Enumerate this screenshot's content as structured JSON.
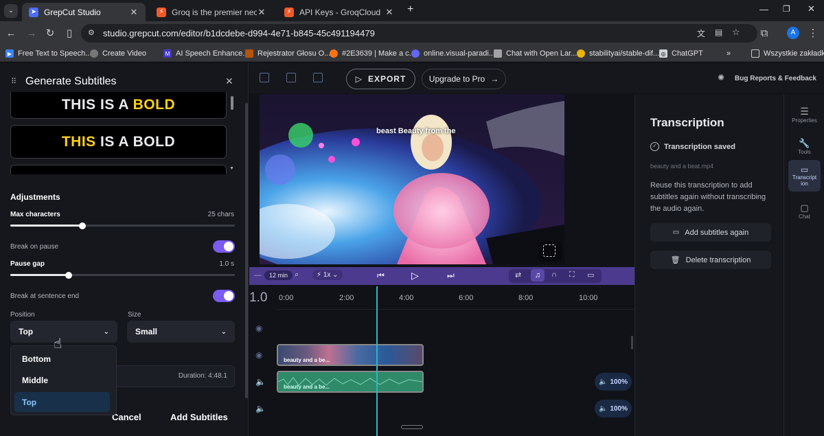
{
  "browser": {
    "tabs": [
      {
        "label": "GrepCut Studio",
        "icon": "grepcut-favicon",
        "color": "#4a6cf7",
        "active": true
      },
      {
        "label": "Groq is the premier neocloud fo",
        "icon": "groq-favicon",
        "color": "#f05a28",
        "active": false
      },
      {
        "label": "API Keys - GroqCloud",
        "icon": "groq-favicon",
        "color": "#f05a28",
        "active": false
      }
    ],
    "url": "studio.grepcut.com/editor/b1dcdebe-d994-4e71-b845-45c491194479",
    "profile_initial": "A",
    "bookmarks": [
      {
        "label": "Free Text to Speech...",
        "color": "#3b82f6"
      },
      {
        "label": "Create Video",
        "color": "#777"
      },
      {
        "label": "AI Speech Enhance...",
        "color": "#4338ca"
      },
      {
        "label": "Rejestrator Głosu O...",
        "color": "#b45309"
      },
      {
        "label": "#2E3639 | Make a c...",
        "color": "#f97316"
      },
      {
        "label": "online.visual-paradi...",
        "color": "#6366f1"
      },
      {
        "label": "Chat with Open Lar...",
        "color": "#a3a3a3"
      },
      {
        "label": "stabilityai/stable-dif...",
        "color": "#eab308"
      },
      {
        "label": "ChatGPT",
        "color": "#d1d5db"
      }
    ],
    "all_bookmarks": "Wszystkie zakładki"
  },
  "panel": {
    "title": "Generate Subtitles",
    "preset1": {
      "white": "THIS IS A ",
      "yellow": "BOLD"
    },
    "preset2": {
      "yellow": "THIS",
      "white": " IS A BOLD"
    },
    "adjustments": "Adjustments",
    "max_chars_label": "Max characters",
    "max_chars_value": "25 chars",
    "max_chars_fraction": 0.32,
    "break_on_pause": "Break on pause",
    "pause_gap_label": "Pause gap",
    "pause_gap_value": "1.0 s",
    "pause_gap_fraction": 0.26,
    "break_sentence": "Break at sentence end",
    "position_label": "Position",
    "position_value": "Top",
    "size_label": "Size",
    "size_value": "Small",
    "options": [
      "Bottom",
      "Middle",
      "Top"
    ],
    "duration": "Duration: 4:48.1",
    "cancel": "Cancel",
    "add_subtitles": "Add Subtitles"
  },
  "toolbar": {
    "export": "EXPORT",
    "upgrade": "Upgrade to Pro",
    "bug": "Bug Reports & Feedback"
  },
  "video": {
    "caption": "beast Beauty from the"
  },
  "transcription": {
    "title": "Transcription",
    "saved": "Transcription saved",
    "file": "beauty and a beat.mp4",
    "description": "Reuse this transcription to add subtitles again without transcribing the audio again.",
    "add_again": "Add subtitles again",
    "delete": "Delete transcription"
  },
  "rail": [
    {
      "label": "Properties",
      "icon": "sliders-icon"
    },
    {
      "label": "Tools",
      "icon": "wrench-icon"
    },
    {
      "label": "Transcript ion",
      "icon": "captions-icon"
    },
    {
      "label": "Chat",
      "icon": "chat-icon"
    }
  ],
  "timeline": {
    "zoom": "12 min",
    "speed": "1x",
    "scale": "1.0",
    "marks": [
      "0:00",
      "2:00",
      "4:00",
      "6:00",
      "8:00",
      "10:00"
    ],
    "clip_label": "beauty and a be...",
    "audio_label": "beauty and a be...",
    "vol1": "100%",
    "vol2": "100%"
  }
}
